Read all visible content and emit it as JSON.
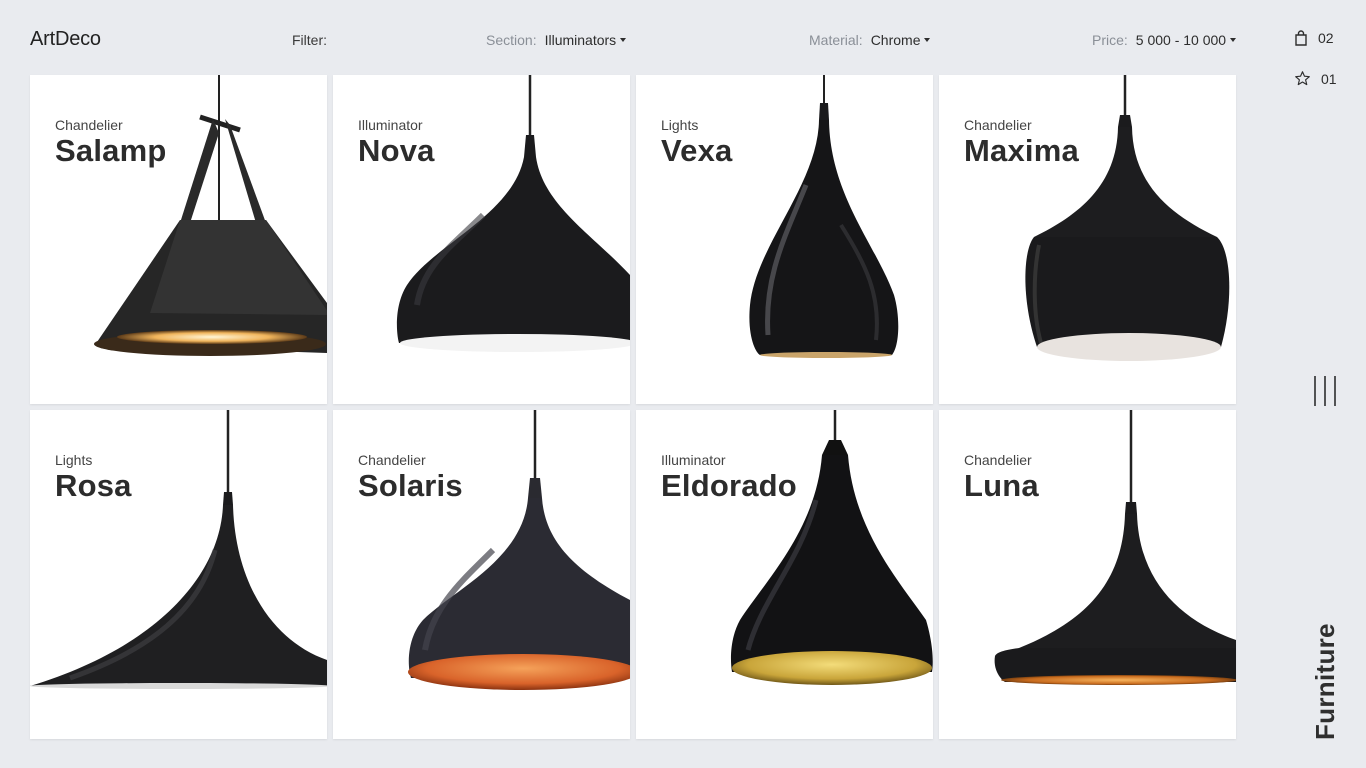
{
  "brand": {
    "logo_part1": "Art",
    "logo_part2": "Deco"
  },
  "filters": {
    "label": "Filter:",
    "section": {
      "label": "Section:",
      "value": "Illuminators"
    },
    "material": {
      "label": "Material:",
      "value": "Chrome"
    },
    "price": {
      "label": "Price:",
      "value": "5 000 - 10 000"
    }
  },
  "rail": {
    "cart_count": "02",
    "favorites_count": "01",
    "section_title": "Furniture"
  },
  "products": [
    {
      "category": "Chandelier",
      "name": "Salamp"
    },
    {
      "category": "Illuminator",
      "name": "Nova"
    },
    {
      "category": "Lights",
      "name": "Vexa"
    },
    {
      "category": "Chandelier",
      "name": "Maxima"
    },
    {
      "category": "Lights",
      "name": "Rosa"
    },
    {
      "category": "Chandelier",
      "name": "Solaris"
    },
    {
      "category": "Illuminator",
      "name": "Eldorado"
    },
    {
      "category": "Chandelier",
      "name": "Luna"
    }
  ],
  "colors": {
    "background": "#e9ebef",
    "card": "#ffffff",
    "lamp_black": "#1b1b1d",
    "copper_inner": "#d9632a",
    "gold_inner": "#c9a53a"
  }
}
